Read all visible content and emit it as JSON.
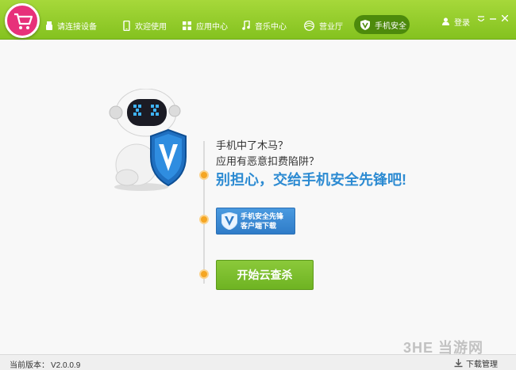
{
  "topbar": {
    "device_label": "请连接设备",
    "nav": {
      "welcome": "欢迎使用",
      "apps": "应用中心",
      "music": "音乐中心",
      "hall": "营业厅",
      "security": "手机安全"
    },
    "login": "登录",
    "accent_color": "#8bc728"
  },
  "main": {
    "question1": "手机中了木马？",
    "question2": "应用有恶意扣费陷阱？",
    "headline": "别担心，交给手机安全先锋吧!",
    "download_line1": "手机安全先锋",
    "download_line2": "客户端下载",
    "scan_button": "开始云查杀"
  },
  "bottom": {
    "version_label": "当前版本：",
    "version": "V2.0.0.9",
    "download_manage": "下载管理"
  },
  "watermark": "3HE 当游网",
  "icons": [
    "cart-icon",
    "usb-icon",
    "phone-icon",
    "apps-icon",
    "music-note-icon",
    "hall-icon",
    "v-shield-icon",
    "user-icon",
    "menu-icon",
    "minimize-icon",
    "close-icon",
    "download-icon"
  ]
}
